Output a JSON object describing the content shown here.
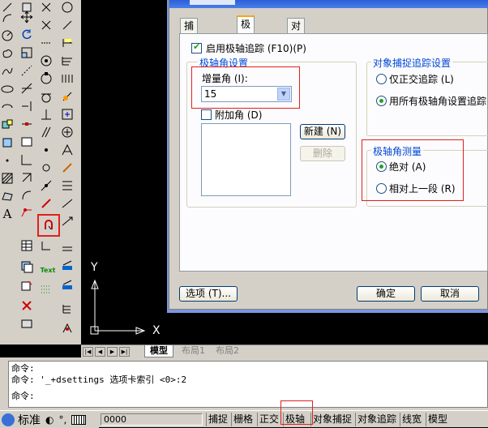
{
  "dialog": {
    "tabs": [
      {
        "label": "捕捉和栅格",
        "active": false
      },
      {
        "label": "极轴追踪",
        "active": true
      },
      {
        "label": "对象捕捉",
        "active": false
      }
    ],
    "enable_polar": {
      "label": "启用极轴追踪 (F10)(P)",
      "checked": true
    },
    "polar_settings": {
      "title": "极轴角设置",
      "increment_label": "增量角 (I):",
      "increment_value": "15",
      "additional_label": "附加角 (D)",
      "additional_checked": false,
      "new_button": "新建 (N)",
      "delete_button": "删除"
    },
    "snap_tracking": {
      "title": "对象捕捉追踪设置",
      "options": [
        {
          "label": "仅正交追踪 (L)",
          "selected": false
        },
        {
          "label": "用所有极轴角设置追踪",
          "selected": true
        }
      ]
    },
    "polar_measure": {
      "title": "极轴角测量",
      "options": [
        {
          "label": "绝对 (A)",
          "selected": true
        },
        {
          "label": "相对上一段 (R)",
          "selected": false
        }
      ]
    },
    "options_button": "选项 (T)...",
    "ok_button": "确定",
    "cancel_button": "取消"
  },
  "canvas": {
    "ucs_x": "X",
    "ucs_y": "Y"
  },
  "layout_tabs": [
    "模型",
    "布局1",
    "布局2"
  ],
  "command": {
    "lines": [
      "命令:",
      "命令: '_+dsettings 选项卡索引 <0>:2",
      "命令:"
    ]
  },
  "status": {
    "ime_label": "标准",
    "coords": "0000",
    "buttons": [
      "捕捉",
      "栅格",
      "正交",
      "极轴",
      "对象捕捉",
      "对象追踪",
      "线宽",
      "模型"
    ]
  },
  "toolbar": {
    "text_button": "Text",
    "a_label": "A"
  },
  "colors": {
    "highlight": "#e0201c",
    "group_title": "#0046d5",
    "accent": "#21a121"
  }
}
